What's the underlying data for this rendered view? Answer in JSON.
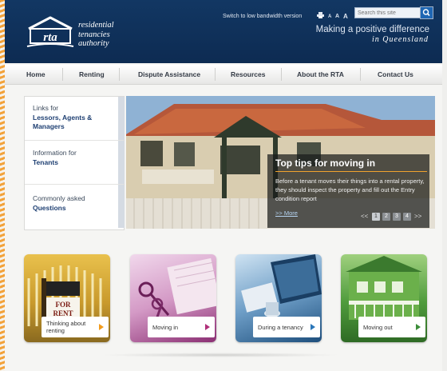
{
  "header": {
    "logo_text": "rta",
    "org_name_line1": "residential",
    "org_name_line2": "tenancies",
    "org_name_line3": "authority",
    "low_bandwidth_link": "Switch to low bandwidth version",
    "text_size_small": "A",
    "text_size_medium": "A",
    "text_size_large": "A",
    "search_placeholder": "Search this site",
    "tagline_line1": "Making a positive difference",
    "tagline_line2": "in Queensland"
  },
  "nav": {
    "items": [
      {
        "label": "Home"
      },
      {
        "label": "Renting"
      },
      {
        "label": "Dispute Assistance"
      },
      {
        "label": "Resources"
      },
      {
        "label": "About the RTA"
      },
      {
        "label": "Contact Us"
      }
    ]
  },
  "side_links": [
    {
      "line1": "Links for",
      "line2": "Lessors, Agents &",
      "line3": "Managers"
    },
    {
      "line1": "Information for",
      "line2": "Tenants",
      "line3": ""
    },
    {
      "line1": "Commonly asked",
      "line2": "Questions",
      "line3": ""
    }
  ],
  "hero": {
    "title": "Top tips for moving in",
    "body": "Before a tenant moves their things into a rental property, they should inspect the property and fill out the Entry condition report",
    "more_link": ">> More",
    "prev_arrow": "<<",
    "next_arrow": ">>",
    "pages": [
      "1",
      "2",
      "3",
      "4"
    ],
    "active_page": "1"
  },
  "tiles": [
    {
      "label_line1": "Thinking about",
      "label_line2": "renting",
      "sign_line1": "FOR",
      "sign_line2": "RENT",
      "accent": "#f29b1c"
    },
    {
      "label_line1": "Moving in",
      "label_line2": "",
      "accent": "#b0307a"
    },
    {
      "label_line1": "During a tenancy",
      "label_line2": "",
      "accent": "#2b77b9"
    },
    {
      "label_line1": "Moving out",
      "label_line2": "",
      "accent": "#3d8d3a"
    }
  ],
  "colors": {
    "header_navy": "#123763",
    "accent_orange": "#f0a32e",
    "link_navy": "#1e3f72"
  }
}
